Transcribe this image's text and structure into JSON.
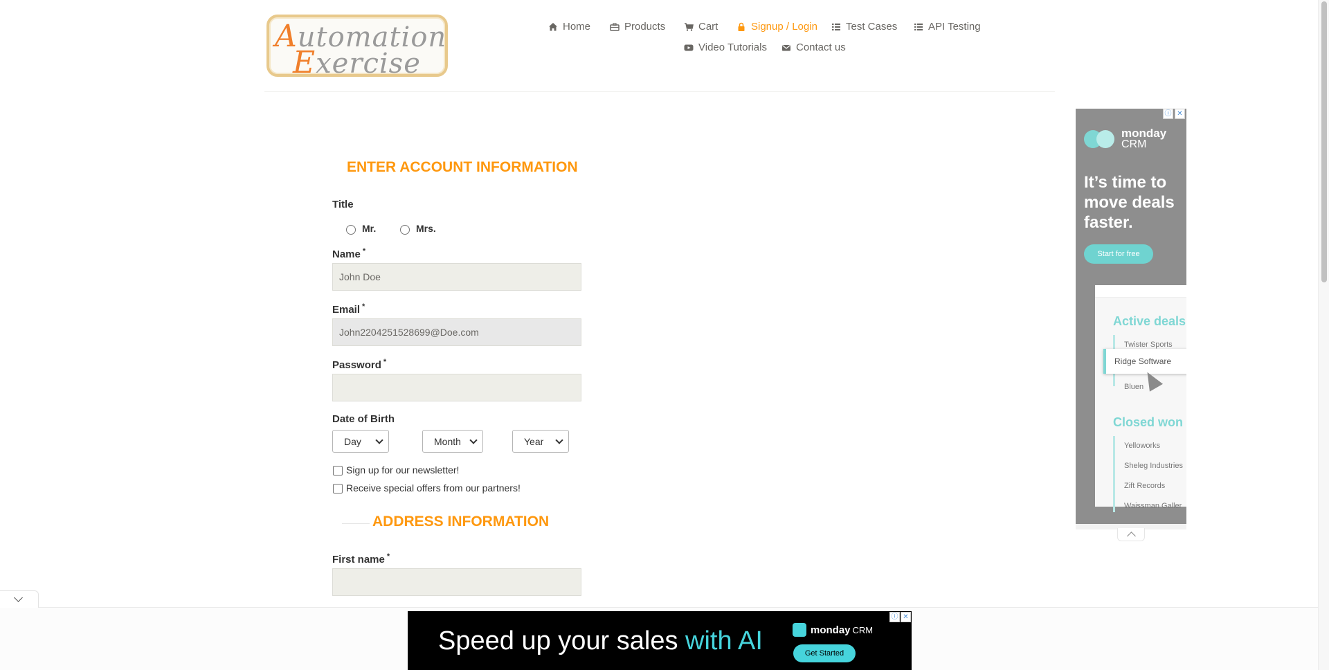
{
  "logo": {
    "line1_cap": "A",
    "line1_rest": "utomation",
    "line2_cap": "E",
    "line2_rest": "xercise"
  },
  "nav": {
    "items": [
      {
        "label": "Home",
        "icon": "home-icon"
      },
      {
        "label": "Products",
        "icon": "briefcase-icon"
      },
      {
        "label": "Cart",
        "icon": "cart-icon"
      },
      {
        "label": "Signup / Login",
        "icon": "lock-icon",
        "active": true
      },
      {
        "label": "Test Cases",
        "icon": "list-icon"
      },
      {
        "label": "API Testing",
        "icon": "list-icon"
      },
      {
        "label": "Video Tutorials",
        "icon": "youtube-icon"
      },
      {
        "label": "Contact us",
        "icon": "envelope-icon"
      }
    ],
    "active_color": "#fe980f"
  },
  "form": {
    "section_account": "ENTER ACCOUNT INFORMATION",
    "title_label": "Title",
    "title_options": [
      "Mr.",
      "Mrs."
    ],
    "name_label": "Name",
    "name_value": "John Doe",
    "email_label": "Email",
    "email_value": "John2204251528699@Doe.com",
    "password_label": "Password",
    "password_value": "",
    "required_mark": "*",
    "dob_label": "Date of Birth",
    "dob_day": "Day",
    "dob_month": "Month",
    "dob_year": "Year",
    "newsletter_label": "Sign up for our newsletter!",
    "offers_label": "Receive special offers from our partners!",
    "section_address": "ADDRESS INFORMATION",
    "first_name_label": "First name",
    "first_name_value": ""
  },
  "side_ad": {
    "brand_name": "monday",
    "brand_sub": "CRM",
    "headline": "It’s time to move deals faster.",
    "cta": "Start for free",
    "section_active": "Active deals",
    "active_rows": [
      "Twister Sports",
      "Ridge Software",
      "Bluen"
    ],
    "section_closed": "Closed won",
    "closed_rows": [
      "Yelloworks",
      "Sheleg Industries",
      "Zift Records",
      "Waissman Galler"
    ],
    "info_icon": "ⓘ",
    "close_icon": "✕"
  },
  "bottom_ad": {
    "message_plain": "Speed up your sales ",
    "message_accent": "with AI",
    "brand_name": "monday",
    "brand_sub": "CRM",
    "cta": "Get Started",
    "info_icon": "ⓘ",
    "close_icon": "✕"
  },
  "colors": {
    "orange": "#fe980f",
    "field_bg": "#eeeee8",
    "ad_teal": "#46d4dc"
  }
}
